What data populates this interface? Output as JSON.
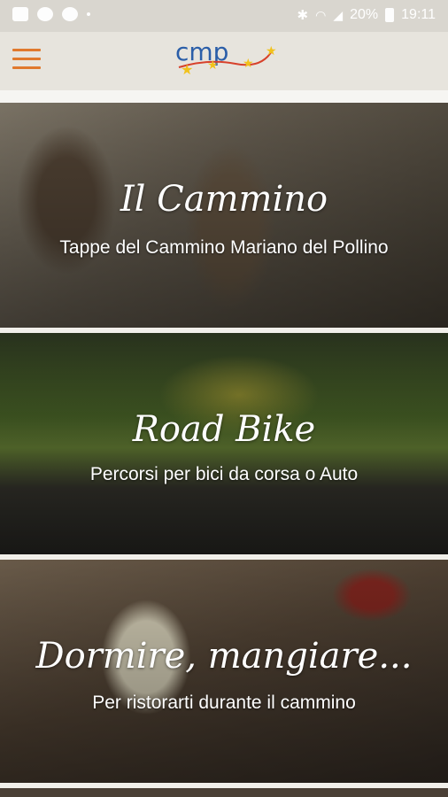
{
  "status_bar": {
    "battery": "20%",
    "time": "19:11",
    "icons": [
      "message-icon",
      "whatsapp-icon",
      "chrome-icon",
      "bluetooth-icon",
      "wifi-icon",
      "signal-icon",
      "battery-icon"
    ]
  },
  "header": {
    "menu_icon": "hamburger-menu-icon",
    "logo_text": "cmp",
    "accent": "#e0792d"
  },
  "cards": [
    {
      "title": "Il Cammino",
      "subtitle": "Tappe del Cammino  Mariano del Pollino"
    },
    {
      "title": "Road Bike",
      "subtitle": "Percorsi per bici da corsa o Auto"
    },
    {
      "title": "Dormire, mangiare...",
      "subtitle": "Per ristorarti durante il cammino"
    }
  ]
}
